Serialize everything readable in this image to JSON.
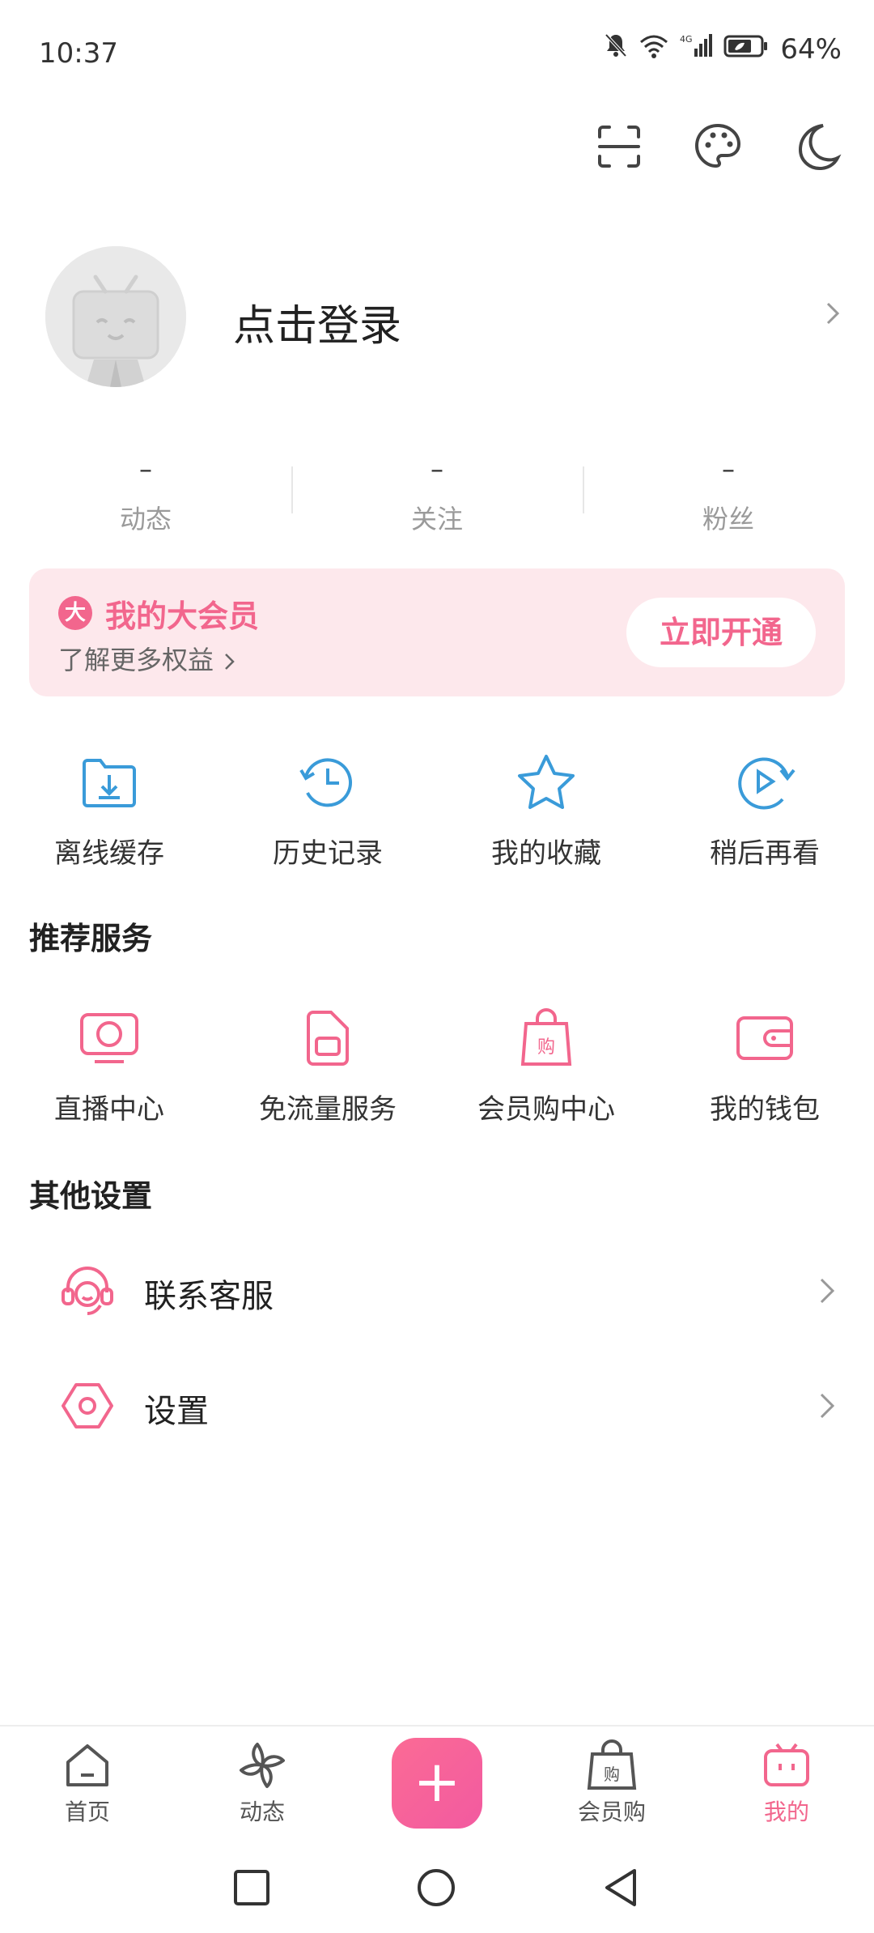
{
  "status_bar": {
    "time": "10:37",
    "battery": "64%",
    "icons": [
      "bell-mute-icon",
      "wifi-icon",
      "signal-4g-icon",
      "battery-icon"
    ]
  },
  "top_actions": {
    "icons": [
      "scan-icon",
      "palette-icon",
      "moon-icon"
    ]
  },
  "profile": {
    "login_label": "点击登录"
  },
  "stats": [
    {
      "value": "–",
      "label": "动态"
    },
    {
      "value": "–",
      "label": "关注"
    },
    {
      "value": "–",
      "label": "粉丝"
    }
  ],
  "vip": {
    "badge": "大",
    "title": "我的大会员",
    "subtitle": "了解更多权益",
    "button": "立即开通"
  },
  "quick_actions": [
    {
      "label": "离线缓存",
      "icon": "download-folder-icon"
    },
    {
      "label": "历史记录",
      "icon": "history-icon"
    },
    {
      "label": "我的收藏",
      "icon": "star-icon"
    },
    {
      "label": "稍后再看",
      "icon": "watch-later-icon"
    }
  ],
  "recommended": {
    "title": "推荐服务",
    "items": [
      {
        "label": "直播中心",
        "icon": "live-tv-icon"
      },
      {
        "label": "免流量服务",
        "icon": "sim-card-icon"
      },
      {
        "label": "会员购中心",
        "icon": "shopping-bag-icon"
      },
      {
        "label": "我的钱包",
        "icon": "wallet-icon"
      }
    ]
  },
  "other_settings": {
    "title": "其他设置",
    "items": [
      {
        "label": "联系客服",
        "icon": "headset-icon"
      },
      {
        "label": "设置",
        "icon": "settings-hex-icon"
      }
    ]
  },
  "bottom_nav": [
    {
      "label": "首页",
      "icon": "home-icon"
    },
    {
      "label": "动态",
      "icon": "pinwheel-icon"
    },
    {
      "label": "会员购",
      "icon": "shopping-bag-icon"
    },
    {
      "label": "我的",
      "icon": "tv-mascot-icon"
    }
  ],
  "plus_button": "+",
  "colors": {
    "accent": "#f2668d",
    "blue_icon": "#3a9bd9",
    "vip_bg": "#fde8ec"
  }
}
